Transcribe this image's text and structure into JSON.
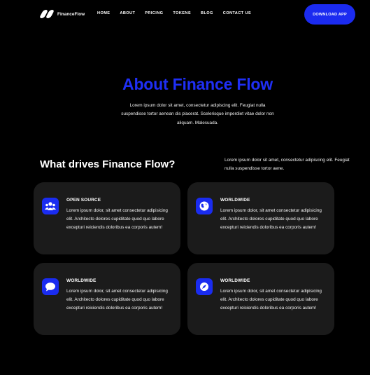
{
  "brand": {
    "name": "FinanceFlow"
  },
  "nav": {
    "items": [
      "HOME",
      "ABOUT",
      "PRICING",
      "TOKENS",
      "BLOG",
      "CONTACT US"
    ],
    "cta_label": "DOWNLOAD APP"
  },
  "hero": {
    "title": "About Finance Flow",
    "text": "Lorem ipsum dolor sit amet, consectetur adipiscing elit. Feugiat nulla suspendisse tortor aenean dis placerat. Scelerisque imperdiet vitae dolor non aliquam. Malesuada."
  },
  "drives": {
    "title": "What drives Finance Flow?",
    "text": "Lorem ipsum dolor sit amet, consectetur adipiscing elit. Feugiat nulla suspendisse tortor aene."
  },
  "cards": [
    {
      "title": "OPEN SOURCE",
      "icon": "users-icon",
      "desc": "Lorem ipsum dolor, sit amet consectetur adipisicing elit. Architecto dolores cupiditate quod quo labore excepturi reiciendis doloribus ea corporis autem!"
    },
    {
      "title": "WORLDWIDE",
      "icon": "globe-icon",
      "desc": "Lorem ipsum dolor, sit amet consectetur adipisicing elit. Architecto dolores cupiditate quod quo labore excepturi reiciendis doloribus ea corporis autem!"
    },
    {
      "title": "WORLDWIDE",
      "icon": "chat-bubble-icon",
      "desc": "Lorem ipsum dolor, sit amet consectetur adipisicing elit. Architecto dolores cupiditate quod quo labore excepturi reiciendis doloribus ea corporis autem!"
    },
    {
      "title": "WORLDWIDE",
      "icon": "compass-icon",
      "desc": "Lorem ipsum dolor, sit amet consectetur adipisicing elit. Architecto dolores cupiditate quod quo labore excepturi reiciendis doloribus ea corporis autem!"
    }
  ],
  "colors": {
    "background": "#000000",
    "accent": "#1b2bf0",
    "card": "#1b1b1b",
    "text": "#ffffff"
  }
}
